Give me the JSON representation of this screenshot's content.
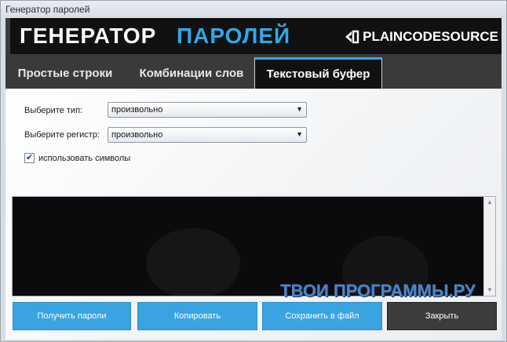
{
  "window": {
    "title": "Генератор паролей"
  },
  "banner": {
    "title_part1": "ГЕНЕРАТОР",
    "title_part2": "ПАРОЛЕЙ",
    "brand": "PLAINCODESOURCE",
    "accent_color": "#2fa9e8"
  },
  "tabs": [
    {
      "label": "Простые строки",
      "active": false
    },
    {
      "label": "Комбинации слов",
      "active": false
    },
    {
      "label": "Текстовый буфер",
      "active": true
    }
  ],
  "form": {
    "type_label": "Выберите тип:",
    "type_value": "произвольно",
    "case_label": "Выберите регистр:",
    "case_value": "произвольно",
    "symbols_label": "использовать символы",
    "symbols_checked": true
  },
  "output": {
    "text": ""
  },
  "watermark": "ТВОИ ПРОГРАММЫ.РУ",
  "buttons": {
    "get_passwords": "Получить пароли",
    "copy": "Копировать",
    "save_to_file": "Сохранить в файл",
    "close": "Закрыть"
  },
  "icons": {
    "dropdown": "chevron-down-icon",
    "check": "check-icon",
    "brand": "plaincodesource-logo-icon"
  }
}
